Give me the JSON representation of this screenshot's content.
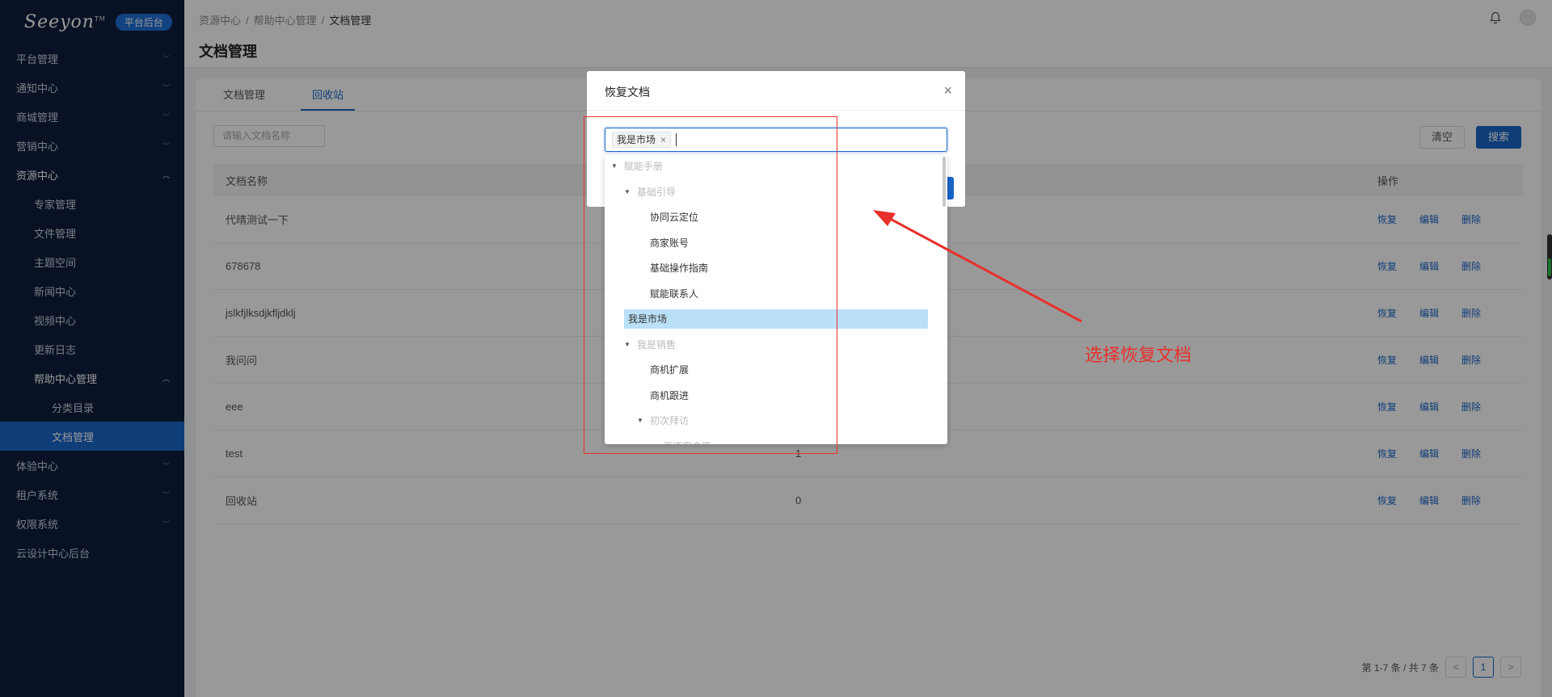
{
  "sidebar": {
    "logo": "Seeyon",
    "logo_mark": "TM",
    "badge": "平台后台",
    "items": [
      {
        "label": "平台管理",
        "level": 0
      },
      {
        "label": "通知中心",
        "level": 0
      },
      {
        "label": "商城管理",
        "level": 0
      },
      {
        "label": "营销中心",
        "level": 0
      },
      {
        "label": "资源中心",
        "level": 0,
        "open": true
      },
      {
        "label": "专家管理",
        "level": 1
      },
      {
        "label": "文件管理",
        "level": 1
      },
      {
        "label": "主题空间",
        "level": 1
      },
      {
        "label": "新闻中心",
        "level": 1
      },
      {
        "label": "视频中心",
        "level": 1
      },
      {
        "label": "更新日志",
        "level": 1
      },
      {
        "label": "帮助中心管理",
        "level": 1,
        "open": true
      },
      {
        "label": "分类目录",
        "level": 2
      },
      {
        "label": "文档管理",
        "level": 2,
        "active": true
      },
      {
        "label": "体验中心",
        "level": 0
      },
      {
        "label": "租户系统",
        "level": 0
      },
      {
        "label": "权限系统",
        "level": 0
      },
      {
        "label": "云设计中心后台",
        "level": 0
      }
    ]
  },
  "header": {
    "breadcrumb": [
      "资源中心",
      "帮助中心管理",
      "文档管理"
    ],
    "title": "文档管理",
    "bell_icon": "bell-icon",
    "avatar_icon": "user-avatar-icon"
  },
  "tabs": [
    {
      "label": "文档管理",
      "active": false
    },
    {
      "label": "回收站",
      "active": true
    }
  ],
  "search": {
    "placeholder": "请输入文档名称",
    "clear_label": "清空",
    "search_label": "搜索"
  },
  "table": {
    "headers": [
      "文档名称",
      "",
      "操作"
    ],
    "rows": [
      {
        "name": "代晴测试一下",
        "count": ""
      },
      {
        "name": "678678",
        "count": ""
      },
      {
        "name": "jslkfjlksdjkfljdklj",
        "count": ""
      },
      {
        "name": "我问问",
        "count": ""
      },
      {
        "name": "eee",
        "count": ""
      },
      {
        "name": "test",
        "count": "1"
      },
      {
        "name": "回收站",
        "count": "0"
      }
    ],
    "ops": [
      "恢复",
      "编辑",
      "删除"
    ]
  },
  "pagination": {
    "summary": "第 1-7 条 / 共 7 条",
    "current": "1",
    "prev": "<",
    "next": ">"
  },
  "modal": {
    "title": "恢复文档",
    "close": "×",
    "selected_tag": "我是市场",
    "tag_remove": "×",
    "tree": [
      {
        "label": "赋能手册",
        "depth": 0,
        "expanded": true,
        "disabled": true
      },
      {
        "label": "基础引导",
        "depth": 1,
        "expanded": true,
        "disabled": true
      },
      {
        "label": "协同云定位",
        "depth": 2
      },
      {
        "label": "商家账号",
        "depth": 2
      },
      {
        "label": "基础操作指南",
        "depth": 2
      },
      {
        "label": "赋能联系人",
        "depth": 2
      },
      {
        "label": "我是市场",
        "depth": 1,
        "selected": true
      },
      {
        "label": "我是销售",
        "depth": 1,
        "expanded": true,
        "disabled": true
      },
      {
        "label": "商机扩展",
        "depth": 2
      },
      {
        "label": "商机跟进",
        "depth": 2
      },
      {
        "label": "初次拜访",
        "depth": 2,
        "expanded": true,
        "disabled": true
      },
      {
        "label": "渠道客户管",
        "depth": 3,
        "disabled": true
      }
    ]
  },
  "annotation": {
    "text": "选择恢复文档",
    "color": "#e8302b"
  }
}
